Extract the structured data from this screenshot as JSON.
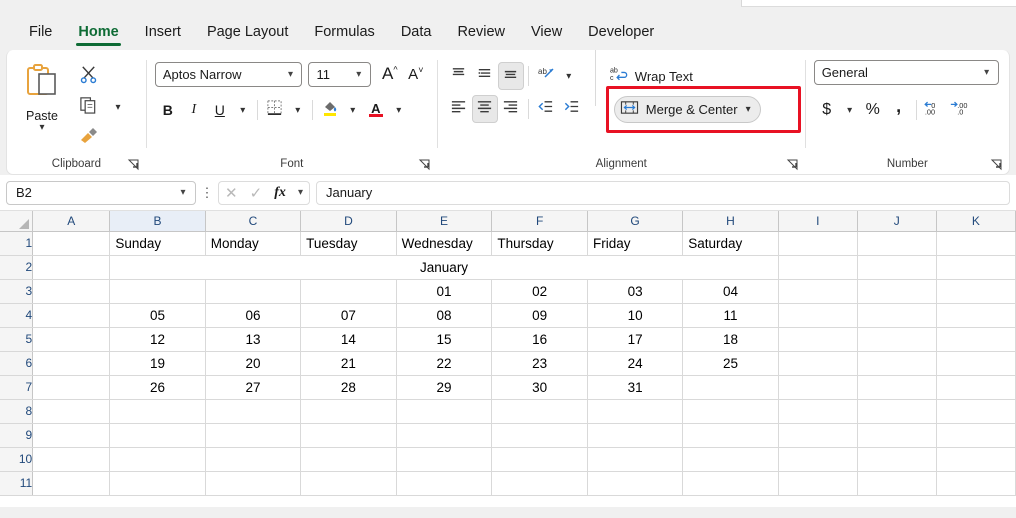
{
  "ribbon": {
    "tabs": [
      {
        "label": "File",
        "active": false
      },
      {
        "label": "Home",
        "active": true
      },
      {
        "label": "Insert",
        "active": false
      },
      {
        "label": "Page Layout",
        "active": false
      },
      {
        "label": "Formulas",
        "active": false
      },
      {
        "label": "Data",
        "active": false
      },
      {
        "label": "Review",
        "active": false
      },
      {
        "label": "View",
        "active": false
      },
      {
        "label": "Developer",
        "active": false
      }
    ],
    "groups": {
      "clipboard": {
        "label": "Clipboard",
        "paste_label": "Paste",
        "icons": [
          "paste-icon",
          "cut-scissors-icon",
          "copy-icon",
          "format-painter-icon"
        ]
      },
      "font": {
        "label": "Font",
        "font_name": "Aptos Narrow",
        "font_size": "11",
        "grow_font": "A",
        "shrink_font": "A",
        "bold": "B",
        "italic": "I",
        "underline": "U"
      },
      "alignment": {
        "label": "Alignment",
        "wrap_text": "Wrap Text",
        "merge_center": "Merge & Center",
        "highlight_color": "#e81123",
        "highlighted_control": "merge-and-center"
      },
      "number": {
        "label": "Number",
        "format": "General",
        "currency": "$",
        "percent": "%",
        "comma": ",",
        "increase_decimal": ".00",
        "decrease_decimal": ".00"
      }
    }
  },
  "formula_bar": {
    "name_box": "B2",
    "formula": "January",
    "cancel": "cancel-icon",
    "enter": "enter-icon",
    "insert_function": "fx"
  },
  "sheet": {
    "columns": [
      "A",
      "B",
      "C",
      "D",
      "E",
      "F",
      "G",
      "H",
      "I",
      "J",
      "K"
    ],
    "selected_column": "B",
    "selected_row": 2,
    "rows": [
      "1",
      "2",
      "3",
      "4",
      "5",
      "6",
      "7",
      "8",
      "9",
      "10",
      "11"
    ],
    "merged_title": "January",
    "merged_range": "B2:H2",
    "data": {
      "row1": [
        "",
        "Sunday",
        "Monday",
        "Tuesday",
        "Wednesday",
        "Thursday",
        "Friday",
        "Saturday",
        "",
        "",
        ""
      ],
      "row3": [
        "",
        "",
        "",
        "",
        "01",
        "02",
        "03",
        "04",
        "",
        "",
        ""
      ],
      "row4": [
        "",
        "05",
        "06",
        "07",
        "08",
        "09",
        "10",
        "11",
        "",
        "",
        ""
      ],
      "row5": [
        "",
        "12",
        "13",
        "14",
        "15",
        "16",
        "17",
        "18",
        "",
        "",
        ""
      ],
      "row6": [
        "",
        "19",
        "20",
        "21",
        "22",
        "23",
        "24",
        "25",
        "",
        "",
        ""
      ],
      "row7": [
        "",
        "26",
        "27",
        "28",
        "29",
        "30",
        "31",
        "",
        "",
        "",
        ""
      ],
      "row8": [
        "",
        "",
        "",
        "",
        "",
        "",
        "",
        "",
        "",
        "",
        ""
      ],
      "row9": [
        "",
        "",
        "",
        "",
        "",
        "",
        "",
        "",
        "",
        "",
        ""
      ],
      "row10": [
        "",
        "",
        "",
        "",
        "",
        "",
        "",
        "",
        "",
        "",
        ""
      ],
      "row11": [
        "",
        "",
        "",
        "",
        "",
        "",
        "",
        "",
        "",
        "",
        ""
      ]
    }
  }
}
